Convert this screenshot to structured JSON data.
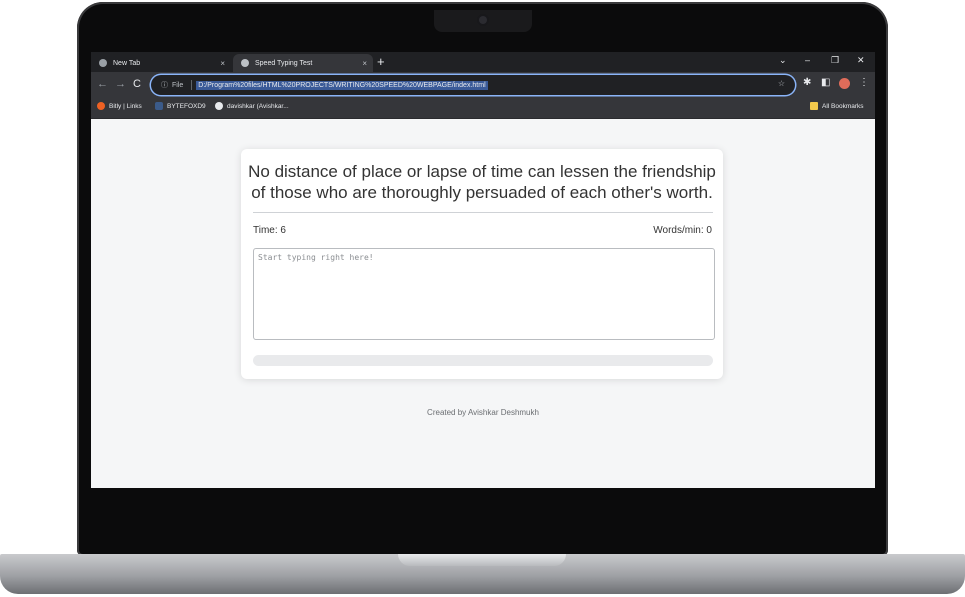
{
  "browser": {
    "tabs": [
      {
        "title": "New Tab",
        "active": false
      },
      {
        "title": "Speed Typing Test",
        "active": true
      }
    ],
    "close_glyph": "×",
    "new_tab_glyph": "+",
    "address": {
      "scheme_label": "File",
      "url": "D:/Program%20files/HTML%20PROJECTS/WRITING%20SPEED%20WEBPAGE/index.html"
    },
    "bookmarks": [
      {
        "label": "Bitly | Links",
        "icon": "bitly-icon"
      },
      {
        "label": "BYTEFOXD9",
        "icon": "bytefox-icon"
      },
      {
        "label": "davishkar (Avishkar...",
        "icon": "github-icon"
      }
    ],
    "all_bookmarks_label": "All Bookmarks",
    "accent_color": "#8ab4f8"
  },
  "app": {
    "quote": "No distance of place or lapse of time can lessen the friendship of those who are thoroughly persuaded of each other's worth.",
    "time_label": "Time: 6",
    "wpm_label": "Words/min: 0",
    "input_placeholder": "Start typing right here!",
    "input_value": "",
    "progress": 0,
    "credit": "Created by Avishkar Deshmukh"
  }
}
